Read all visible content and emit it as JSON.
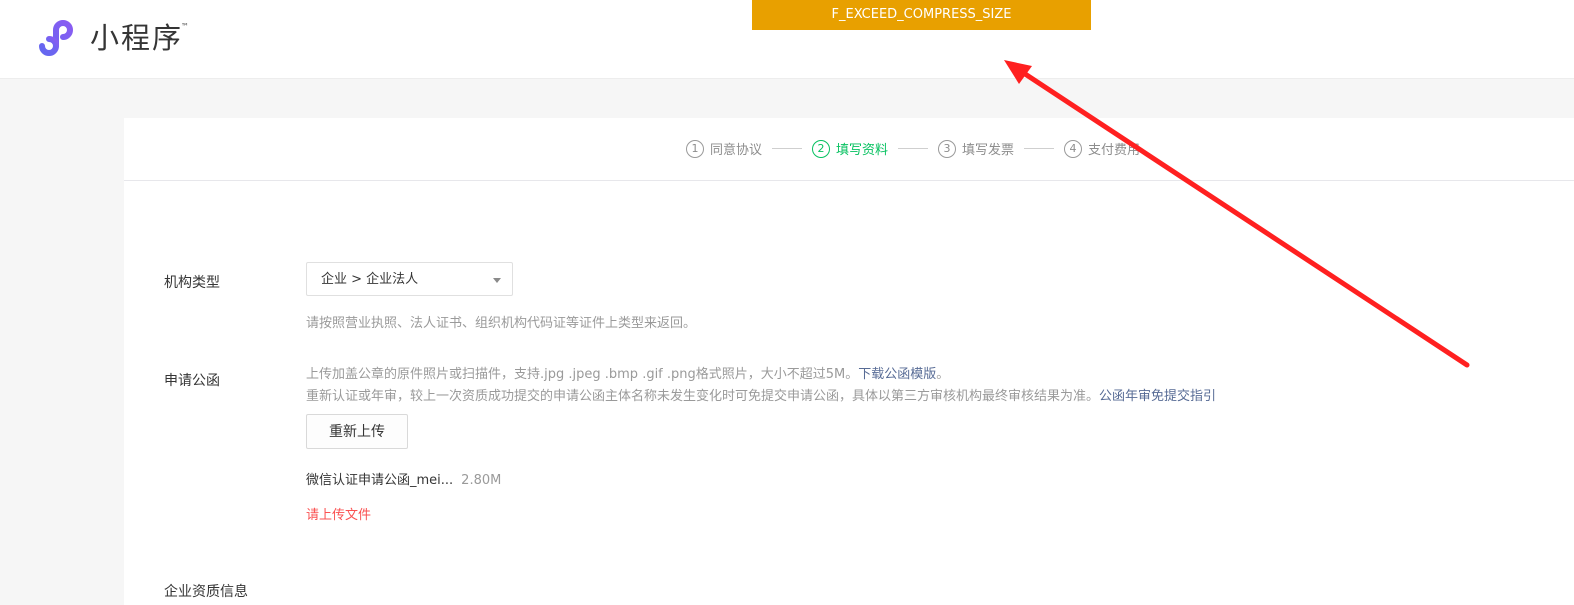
{
  "header": {
    "logo_text": "小程序",
    "trademark": "™"
  },
  "toast": {
    "text": "F_EXCEED_COMPRESS_SIZE"
  },
  "steps": [
    {
      "num": "1",
      "label": "同意协议"
    },
    {
      "num": "2",
      "label": "填写资料"
    },
    {
      "num": "3",
      "label": "填写发票"
    },
    {
      "num": "4",
      "label": "支付费用"
    }
  ],
  "form": {
    "org_type": {
      "label": "机构类型",
      "selected": "企业 > 企业法人",
      "hint": "请按照营业执照、法人证书、组织机构代码证等证件上类型来返回。"
    },
    "letter": {
      "label": "申请公函",
      "hint_1": "上传加盖公章的原件照片或扫描件，支持.jpg .jpeg .bmp .gif .png格式照片，大小不超过5M。",
      "download_link": "下载公函模版",
      "hint_1_end": "。",
      "hint_2": "重新认证或年审，较上一次资质成功提交的申请公函主体名称未发生变化时可免提交申请公函，具体以第三方审核机构最终审核结果为准。",
      "guide_link": "公函年审免提交指引",
      "reupload_button": "重新上传",
      "file_name": "微信认证申请公函_mei...",
      "file_size": "2.80M",
      "error": "请上传文件"
    },
    "qualification": {
      "label": "企业资质信息"
    }
  },
  "colors": {
    "toast_bg": "#e8a000",
    "active_step": "#07c160",
    "link": "#576b95",
    "error": "#fa5151",
    "annotation_arrow": "#ff2020"
  }
}
